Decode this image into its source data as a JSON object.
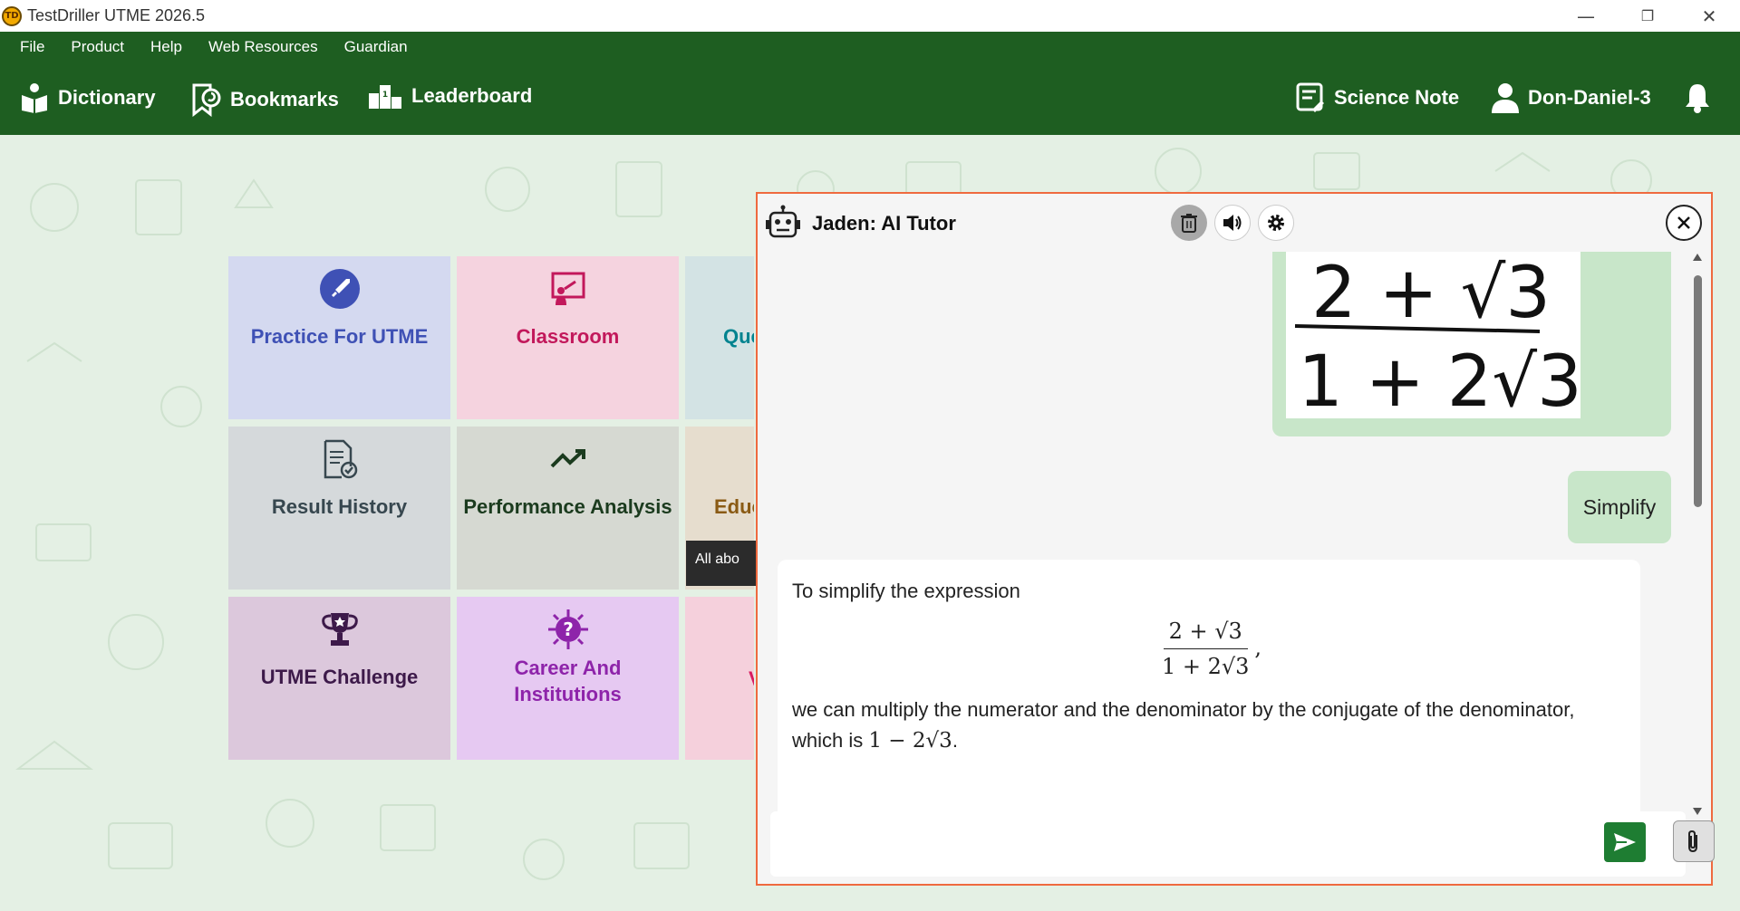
{
  "window": {
    "title": "TestDriller UTME 2026.5",
    "logo_text": "TD",
    "minimize": "—",
    "restore": "❐",
    "close": "✕"
  },
  "menu": [
    "File",
    "Product",
    "Help",
    "Web Resources",
    "Guardian"
  ],
  "toolbar": {
    "dictionary": "Dictionary",
    "bookmarks": "Bookmarks",
    "leaderboard": "Leaderboard",
    "science_note": "Science Note",
    "user": "Don-Daniel-3"
  },
  "tiles": [
    {
      "label": "Practice For UTME",
      "color": "#3f51b5",
      "bg": "#d4d9f0",
      "icon": "rocket-icon"
    },
    {
      "label": "Classroom",
      "color": "#c2185b",
      "bg": "#f5d3df",
      "icon": "classroom-icon"
    },
    {
      "label": "Que",
      "color": "#00838f",
      "bg": "#d3e3e4",
      "icon": "question-icon"
    },
    {
      "label": "Result History",
      "color": "#37474f",
      "bg": "#d5d9db",
      "icon": "document-check-icon"
    },
    {
      "label": "Performance Analysis",
      "color": "#1b3b1e",
      "bg": "#d6d9d2",
      "icon": "trend-icon"
    },
    {
      "label": "Educa",
      "color": "#8a5a14",
      "bg": "#e6ddce",
      "icon": "education-icon"
    },
    {
      "label": "UTME Challenge",
      "color": "#3d1a4a",
      "bg": "#dcc8dc",
      "icon": "trophy-icon"
    },
    {
      "label": "Career And Institutions",
      "color": "#8e24aa",
      "bg": "#e6c9f2",
      "icon": "career-icon"
    },
    {
      "label": "V",
      "color": "#d81b60",
      "bg": "#f5d0dc",
      "icon": "video-icon"
    }
  ],
  "edu_tooltip": "All abo",
  "chat": {
    "title": "Jaden: AI Tutor",
    "user_message": "Simplify",
    "handwritten_numerator": "2 + √3",
    "handwritten_denominator": "1 + 2√3",
    "bot_intro": "To simplify the expression",
    "math_numerator": "2 + √3",
    "math_denominator": "1 + 2√3",
    "math_trailing": ",",
    "bot_text": "we can multiply the numerator and the denominator by the conjugate of the denominator, which is ",
    "bot_conjugate": "1 − 2√3",
    "bot_end": ".",
    "input_placeholder": ""
  },
  "colors": {
    "header_green": "#1e5e21",
    "chat_border": "#ef6a3f",
    "bubble_green": "#c8e6c9",
    "send_green": "#1e7d32"
  }
}
